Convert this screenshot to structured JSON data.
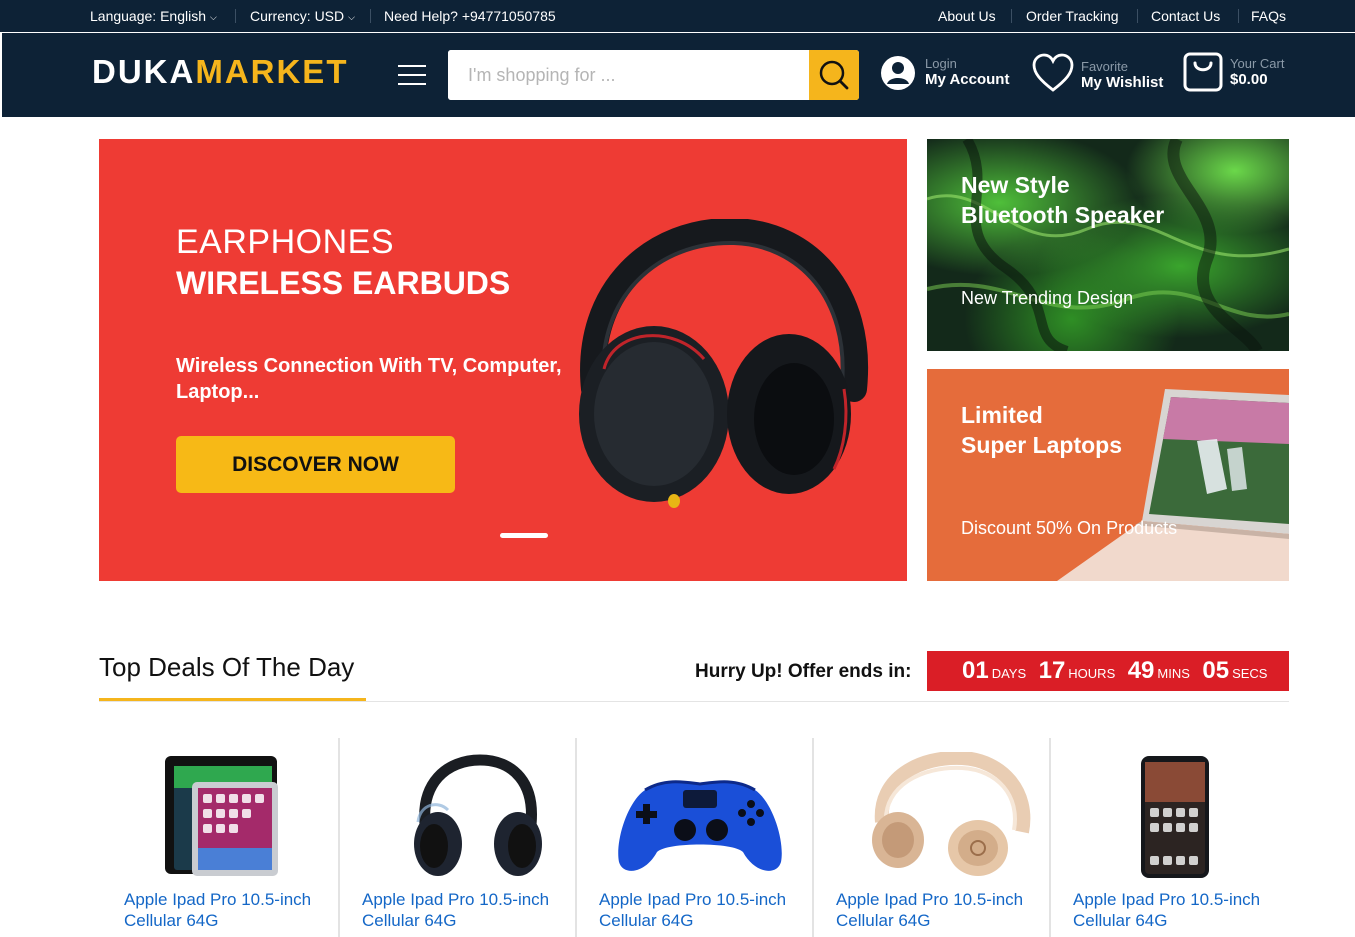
{
  "topbar": {
    "language": "Language: English",
    "currency": "Currency: USD",
    "help_label": "Need Help?",
    "help_phone": "+94771050785",
    "links": [
      "About Us",
      "Order Tracking",
      "Contact Us",
      "FAQs"
    ]
  },
  "header": {
    "logo_part1": "DUKA",
    "logo_part2": "MARKET",
    "search_placeholder": "I'm shopping for ...",
    "account": {
      "small": "Login",
      "big": "My Account"
    },
    "wishlist": {
      "small": "Favorite",
      "big": "My Wishlist"
    },
    "cart": {
      "small": "Your Cart",
      "big": "$0.00"
    }
  },
  "hero": {
    "title_line1": "EARPHONES",
    "title_line2": "WIRELESS EARBUDS",
    "subtitle": "Wireless Connection With TV, Computer, Laptop...",
    "button": "DISCOVER NOW"
  },
  "banners": [
    {
      "title_line1": "New Style",
      "title_line2": "Bluetooth Speaker",
      "subtitle": "New Trending Design"
    },
    {
      "title_line1": "Limited",
      "title_line2": "Super Laptops",
      "subtitle": "Discount 50% On Products"
    }
  ],
  "deals": {
    "title": "Top Deals Of The Day",
    "hurry": "Hurry Up! Offer ends in:",
    "countdown": {
      "days": "01",
      "days_label": "DAYS",
      "hours": "17",
      "hours_label": "HOURS",
      "mins": "49",
      "mins_label": "MINS",
      "secs": "05",
      "secs_label": "SECS"
    },
    "products": [
      {
        "name": "Apple Ipad Pro 10.5-inch Cellular 64G",
        "image": "tablet"
      },
      {
        "name": "Apple Ipad Pro 10.5-inch Cellular 64G",
        "image": "headphones"
      },
      {
        "name": "Apple Ipad Pro 10.5-inch Cellular 64G",
        "image": "gamepad"
      },
      {
        "name": "Apple Ipad Pro 10.5-inch Cellular 64G",
        "image": "gold-headphones"
      },
      {
        "name": "Apple Ipad Pro 10.5-inch Cellular 64G",
        "image": "smartphone"
      }
    ]
  },
  "colors": {
    "navy": "#0d2236",
    "accent_yellow": "#f5b51c",
    "hero_red": "#ee3b34",
    "countdown_red": "#da1e26",
    "link_blue": "#1467c7",
    "banner_orange": "#e56c3b"
  }
}
